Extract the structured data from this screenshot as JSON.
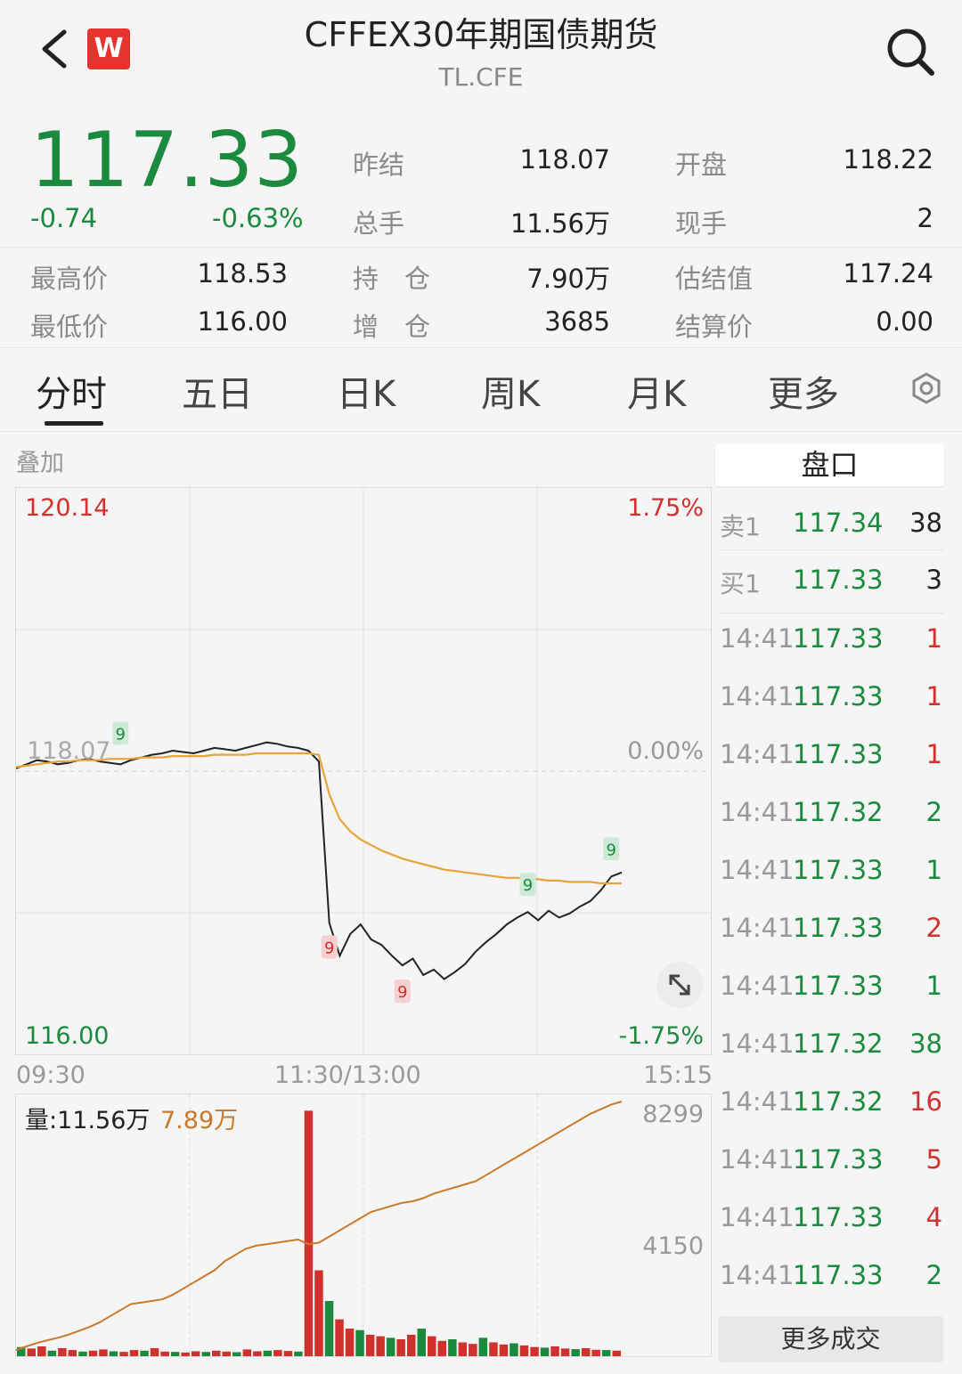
{
  "header": {
    "title": "CFFEX30年期国债期货",
    "code": "TL.CFE",
    "logo_text": "W"
  },
  "quote": {
    "price": "117.33",
    "change": "-0.74",
    "change_pct": "-0.63%",
    "rows": [
      {
        "l1": "昨结",
        "v1": "118.07",
        "l2": "开盘",
        "v2": "118.22"
      },
      {
        "l1": "总手",
        "v1": "11.56万",
        "l2": "现手",
        "v2": "2"
      }
    ],
    "rows2": [
      {
        "l0": "最高价",
        "v0": "118.53",
        "l1": "持　仓",
        "v1": "7.90万",
        "l2": "估结值",
        "v2": "117.24"
      },
      {
        "l0": "最低价",
        "v0": "116.00",
        "l1": "增　仓",
        "v1": "3685",
        "l2": "结算价",
        "v2": "0.00"
      }
    ]
  },
  "tabs": [
    "分时",
    "五日",
    "日K",
    "周K",
    "月K",
    "更多"
  ],
  "overlay_label": "叠加",
  "chart_data": [
    {
      "type": "line",
      "ylim": [
        116.0,
        120.14
      ],
      "y_tick_labels_left": [
        "120.14",
        "118.07",
        "116.00"
      ],
      "y_tick_labels_right": [
        "1.75%",
        "0.00%",
        "-1.75%"
      ],
      "x_tick_labels": [
        "09:30",
        "11:30/13:00",
        "15:15"
      ],
      "reference_price": 118.07,
      "series": [
        {
          "values": [
            118.09,
            118.12,
            118.15,
            118.14,
            118.12,
            118.13,
            118.15,
            118.16,
            118.14,
            118.13,
            118.12,
            118.15,
            118.17,
            118.19,
            118.2,
            118.22,
            118.21,
            118.2,
            118.22,
            118.24,
            118.23,
            118.22,
            118.24,
            118.26,
            118.28,
            118.27,
            118.25,
            118.24,
            118.22,
            118.14,
            116.96,
            116.72,
            116.88,
            116.95,
            116.84,
            116.8,
            116.72,
            116.65,
            116.7,
            116.58,
            116.62,
            116.55,
            116.6,
            116.66,
            116.75,
            116.82,
            116.88,
            116.95,
            117.0,
            117.04,
            116.98,
            117.05,
            117.0,
            117.03,
            117.08,
            117.12,
            117.2,
            117.3,
            117.33
          ]
        },
        {
          "values": [
            118.1,
            118.11,
            118.12,
            118.13,
            118.14,
            118.14,
            118.15,
            118.15,
            118.15,
            118.16,
            118.16,
            118.16,
            118.17,
            118.17,
            118.17,
            118.18,
            118.18,
            118.18,
            118.18,
            118.19,
            118.19,
            118.19,
            118.19,
            118.2,
            118.2,
            118.2,
            118.2,
            118.2,
            118.2,
            118.19,
            117.9,
            117.72,
            117.63,
            117.57,
            117.53,
            117.49,
            117.46,
            117.43,
            117.41,
            117.39,
            117.37,
            117.35,
            117.34,
            117.33,
            117.32,
            117.31,
            117.3,
            117.29,
            117.29,
            117.28,
            117.28,
            117.27,
            117.27,
            117.26,
            117.26,
            117.26,
            117.25,
            117.25,
            117.25
          ]
        }
      ],
      "markers": [
        "9",
        "9",
        "9",
        "9",
        "9"
      ]
    },
    {
      "type": "bar",
      "title": "量:11.56万",
      "secondary_label": "7.89万",
      "ylim": [
        0,
        8299
      ],
      "y_tick_labels": [
        "8299",
        "4150"
      ],
      "series": [
        {
          "values": [
            300,
            250,
            320,
            180,
            260,
            200,
            150,
            180,
            220,
            160,
            140,
            200,
            180,
            260,
            150,
            140,
            120,
            160,
            140,
            180,
            150,
            130,
            220,
            160,
            180,
            200,
            170,
            150,
            8000,
            2800,
            1800,
            1200,
            900,
            850,
            700,
            650,
            600,
            550,
            700,
            900,
            650,
            500,
            550,
            450,
            400,
            600,
            450,
            380,
            420,
            350,
            300,
            280,
            320,
            250,
            230,
            260,
            210,
            200,
            180
          ]
        },
        {
          "values": [
            200,
            320,
            430,
            520,
            600,
            700,
            820,
            950,
            1100,
            1300,
            1500,
            1700,
            1750,
            1800,
            1850,
            2000,
            2200,
            2400,
            2600,
            2800,
            3100,
            3300,
            3500,
            3600,
            3650,
            3700,
            3750,
            3800,
            3650,
            3700,
            3900,
            4100,
            4300,
            4500,
            4700,
            4800,
            4900,
            5000,
            5050,
            5150,
            5300,
            5400,
            5500,
            5600,
            5700,
            5900,
            6100,
            6300,
            6500,
            6700,
            6900,
            7100,
            7300,
            7500,
            7700,
            7900,
            8050,
            8200,
            8299
          ]
        }
      ]
    }
  ],
  "orderbook": {
    "title": "盘口",
    "sell": {
      "label": "卖1",
      "price": "117.34",
      "vol": "38"
    },
    "buy": {
      "label": "买1",
      "price": "117.33",
      "vol": "3"
    }
  },
  "ticks": [
    {
      "time": "14:41",
      "price": "117.33",
      "vol": "1",
      "side": "red"
    },
    {
      "time": "14:41",
      "price": "117.33",
      "vol": "1",
      "side": "red"
    },
    {
      "time": "14:41",
      "price": "117.33",
      "vol": "1",
      "side": "red"
    },
    {
      "time": "14:41",
      "price": "117.32",
      "vol": "2",
      "side": "green"
    },
    {
      "time": "14:41",
      "price": "117.33",
      "vol": "1",
      "side": "green"
    },
    {
      "time": "14:41",
      "price": "117.33",
      "vol": "2",
      "side": "red"
    },
    {
      "time": "14:41",
      "price": "117.33",
      "vol": "1",
      "side": "green"
    },
    {
      "time": "14:41",
      "price": "117.32",
      "vol": "38",
      "side": "green"
    },
    {
      "time": "14:41",
      "price": "117.32",
      "vol": "16",
      "side": "red"
    },
    {
      "time": "14:41",
      "price": "117.33",
      "vol": "5",
      "side": "red"
    },
    {
      "time": "14:41",
      "price": "117.33",
      "vol": "4",
      "side": "red"
    },
    {
      "time": "14:41",
      "price": "117.33",
      "vol": "2",
      "side": "green"
    }
  ],
  "more_trades_label": "更多成交",
  "colors": {
    "up": "#d0312d",
    "down": "#1b8a3e",
    "avg": "#e8a33a",
    "price_line": "#222222",
    "cum_vol": "#c87a2a"
  }
}
